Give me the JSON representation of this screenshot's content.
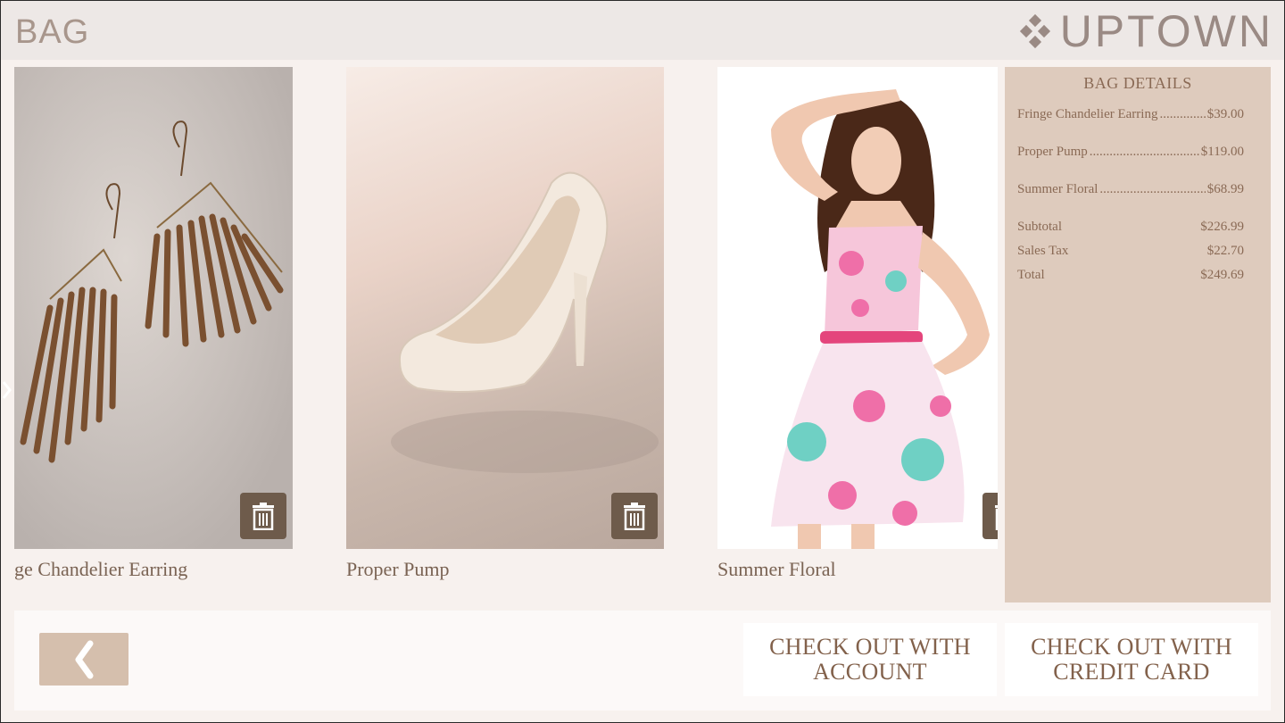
{
  "header": {
    "title": "BAG",
    "brand_name": "UPTOWN",
    "brand_icon": "diamond-cluster-icon"
  },
  "products": [
    {
      "name": "Fringe Chandelier Earring",
      "visible_label": "ge Chandelier Earring",
      "image": "earrings",
      "delete_icon": "trash-icon"
    },
    {
      "name": "Proper Pump",
      "visible_label": "Proper Pump",
      "image": "high-heel-pump",
      "delete_icon": "trash-icon"
    },
    {
      "name": "Summer Floral",
      "visible_label": "Summer Floral",
      "image": "floral-dress",
      "delete_icon": "trash-icon"
    }
  ],
  "bag_details": {
    "heading": "BAG DETAILS",
    "items": [
      {
        "name": "Fringe Chandelier Earring",
        "price": "$39.00"
      },
      {
        "name": "Proper Pump",
        "price": "$119.00"
      },
      {
        "name": "Summer Floral",
        "price": "$68.99"
      }
    ],
    "subtotal_label": "Subtotal",
    "subtotal_value": "$226.99",
    "tax_label": "Sales Tax",
    "tax_value": "$22.70",
    "total_label": "Total",
    "total_value": "$249.69"
  },
  "footer": {
    "back_icon": "chevron-left-icon",
    "checkout_account_line1": "CHECK OUT WITH",
    "checkout_account_line2": "ACCOUNT",
    "checkout_card_line1": "CHECK OUT WITH",
    "checkout_card_line2": "CREDIT CARD"
  },
  "colors": {
    "background": "#f7f1ee",
    "header": "#ede8e6",
    "panel": "#decbbd",
    "accent_text": "#82614b",
    "trash_button": "#6e5b4b",
    "back_button": "#d5bfad"
  }
}
